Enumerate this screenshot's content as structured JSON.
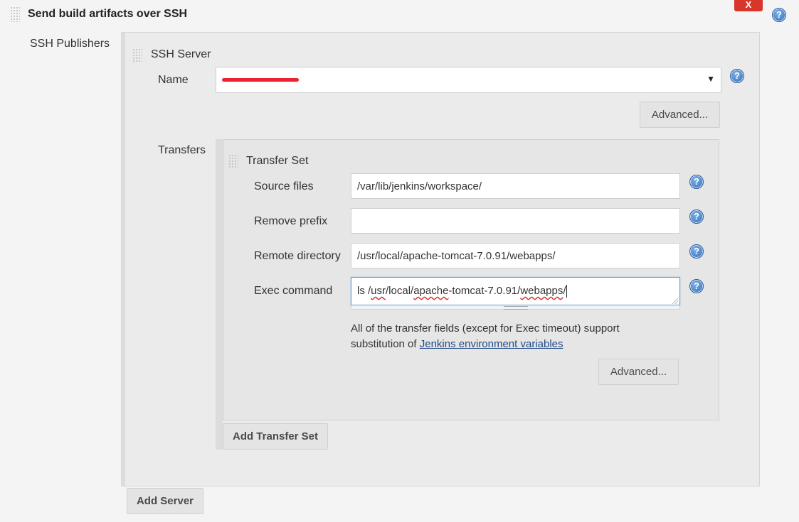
{
  "section": {
    "title": "Send build artifacts over SSH",
    "close_label": "X"
  },
  "publishers": {
    "label": "SSH Publishers"
  },
  "server": {
    "title": "SSH Server",
    "name_label": "Name",
    "advanced_label": "Advanced...",
    "transfers_label": "Transfers",
    "add_server_label": "Add Server"
  },
  "transfer_set": {
    "title": "Transfer Set",
    "source_files_label": "Source files",
    "source_files_value": "/var/lib/jenkins/workspace/",
    "remove_prefix_label": "Remove prefix",
    "remove_prefix_value": "",
    "remote_directory_label": "Remote directory",
    "remote_directory_value": "/usr/local/apache-tomcat-7.0.91/webapps/",
    "exec_command_label": "Exec command",
    "exec_command_parts": [
      "ls /",
      "usr",
      "/local/",
      "apache",
      "-tomcat-7.0.91/",
      "webapps",
      "/"
    ],
    "info_text": "All of the transfer fields (except for Exec timeout) support",
    "info_text_2": "substitution of ",
    "info_link": "Jenkins environment variables",
    "advanced_label": "Advanced...",
    "add_transfer_label": "Add Transfer Set"
  },
  "help_icon_glyph": "?",
  "colors": {
    "close_button": "#d9362b",
    "help_icon": "#2f6bb8",
    "link": "#204a87",
    "focus_border": "#5b9dd9"
  }
}
